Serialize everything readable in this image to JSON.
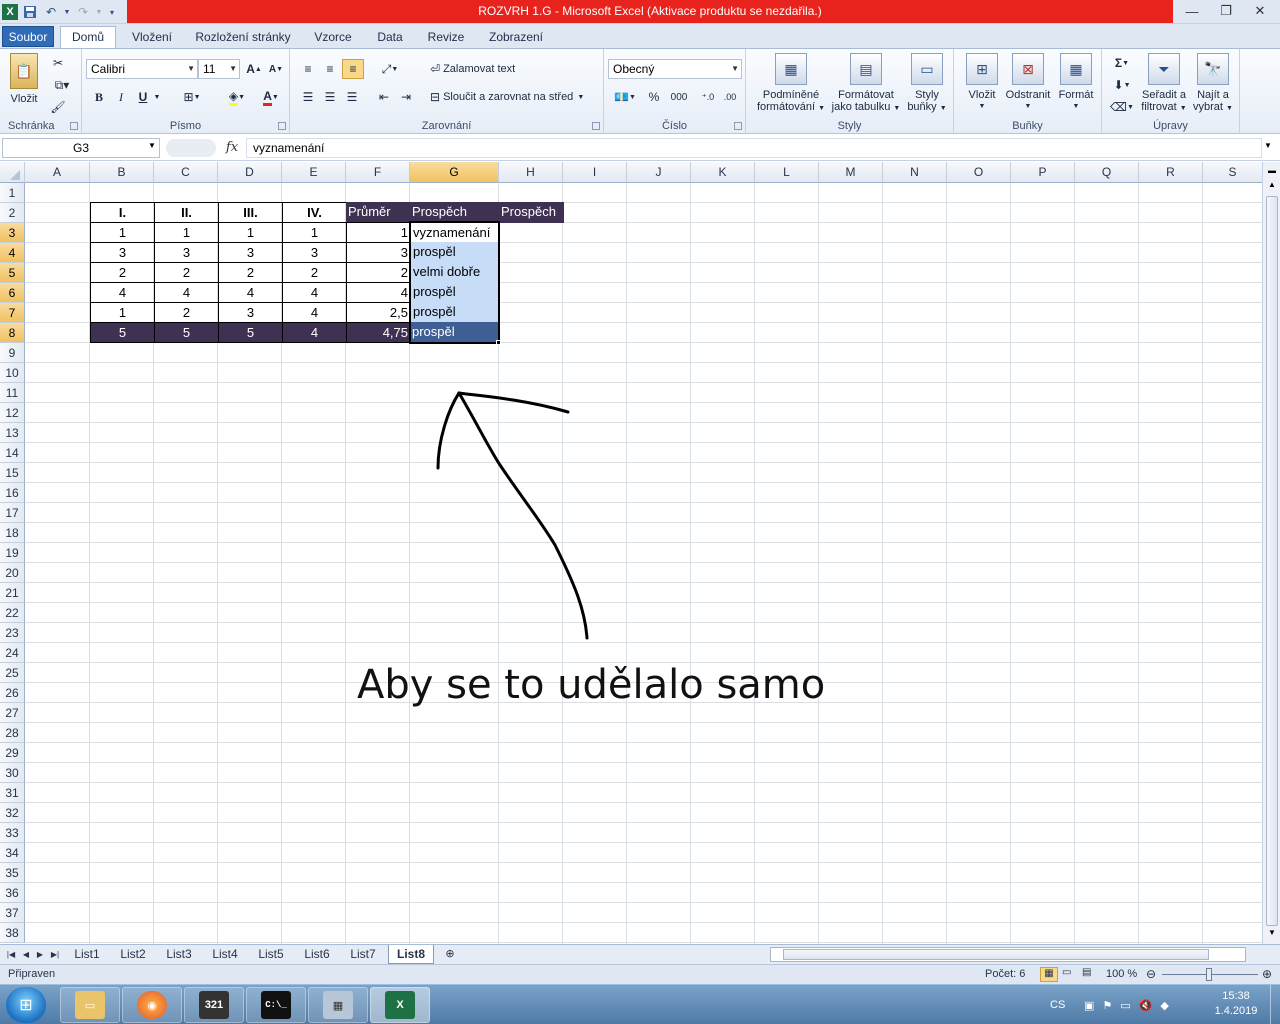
{
  "window": {
    "title": "ROZVRH 1.G  -  Microsoft Excel (Aktivace produktu se nezdařila.)",
    "app_icon": "excel-icon",
    "qat": [
      "save-icon",
      "undo-icon",
      "redo-icon",
      "customize-icon"
    ]
  },
  "tabs": {
    "file": "Soubor",
    "items": [
      "Domů",
      "Vložení",
      "Rozložení stránky",
      "Vzorce",
      "Data",
      "Revize",
      "Zobrazení"
    ],
    "active": "Domů"
  },
  "ribbon": {
    "clipboard": {
      "label": "Schránka",
      "paste": "Vložit"
    },
    "font": {
      "label": "Písmo",
      "name": "Calibri",
      "size": "11",
      "bold": "B",
      "italic": "I",
      "underline": "U"
    },
    "alignment": {
      "label": "Zarovnání",
      "wrap": "Zalamovat text",
      "merge": "Sloučit a zarovnat na střed"
    },
    "number": {
      "label": "Číslo",
      "format": "Obecný",
      "percent": "%",
      "thousands": "000"
    },
    "styles": {
      "label": "Styly",
      "conditional_1": "Podmíněné",
      "conditional_2": "formátování",
      "table_1": "Formátovat",
      "table_2": "jako tabulku",
      "cell_1": "Styly",
      "cell_2": "buňky"
    },
    "cells": {
      "label": "Buňky",
      "insert": "Vložit",
      "delete": "Odstranit",
      "format": "Formát"
    },
    "editing": {
      "label": "Úpravy",
      "sort_1": "Seřadit a",
      "sort_2": "filtrovat",
      "find_1": "Najít a",
      "find_2": "vybrat",
      "sum": "Σ"
    }
  },
  "formula_bar": {
    "name_box": "G3",
    "fx": "fx",
    "content": "vyznamenání"
  },
  "columns": [
    "A",
    "B",
    "C",
    "D",
    "E",
    "F",
    "G",
    "H",
    "I",
    "J",
    "K",
    "L",
    "M",
    "N",
    "O",
    "P",
    "Q",
    "R",
    "S"
  ],
  "selected_column": "G",
  "rows": [
    "1",
    "2",
    "3",
    "4",
    "5",
    "6",
    "7",
    "8",
    "9",
    "10",
    "11",
    "12",
    "13",
    "14",
    "15",
    "16",
    "17",
    "18",
    "19",
    "20",
    "21",
    "22",
    "23",
    "24",
    "25",
    "26",
    "27",
    "28",
    "29",
    "30",
    "31",
    "32",
    "33",
    "34",
    "35",
    "36",
    "37",
    "38"
  ],
  "selected_rows": [
    "3",
    "4",
    "5",
    "6",
    "7",
    "8"
  ],
  "table": {
    "headers": [
      "I.",
      "II.",
      "III.",
      "IV.",
      "Průměr",
      "Prospěch",
      "Prospěch"
    ],
    "rows": [
      {
        "b": "1",
        "c": "1",
        "d": "1",
        "e": "1",
        "f": "1",
        "g": "vyznamenání"
      },
      {
        "b": "3",
        "c": "3",
        "d": "3",
        "e": "3",
        "f": "3",
        "g": "prospěl"
      },
      {
        "b": "2",
        "c": "2",
        "d": "2",
        "e": "2",
        "f": "2",
        "g": "velmi dobře"
      },
      {
        "b": "4",
        "c": "4",
        "d": "4",
        "e": "4",
        "f": "4",
        "g": "prospěl"
      },
      {
        "b": "1",
        "c": "2",
        "d": "3",
        "e": "4",
        "f": "2,5",
        "g": "prospěl"
      },
      {
        "b": "5",
        "c": "5",
        "d": "5",
        "e": "4",
        "f": "4,75",
        "g": "prospěl"
      }
    ]
  },
  "annotation": {
    "text": "Aby se to udělalo samo"
  },
  "sheets": {
    "items": [
      "List1",
      "List2",
      "List3",
      "List4",
      "List5",
      "List6",
      "List7",
      "List8"
    ],
    "active": "List8"
  },
  "status": {
    "ready": "Připraven",
    "count": "Počet: 6",
    "zoom": "100 %"
  },
  "taskbar": {
    "lang": "CS",
    "time": "15:38",
    "date": "1.4.2019",
    "calc_icon_text": "321",
    "cmd_text": "C:\\_"
  },
  "colors": {
    "title_red": "#e8231d",
    "header_dark": "#3f3151",
    "selection": "#c6dcf7",
    "selection_dark": "#3f5f94"
  }
}
